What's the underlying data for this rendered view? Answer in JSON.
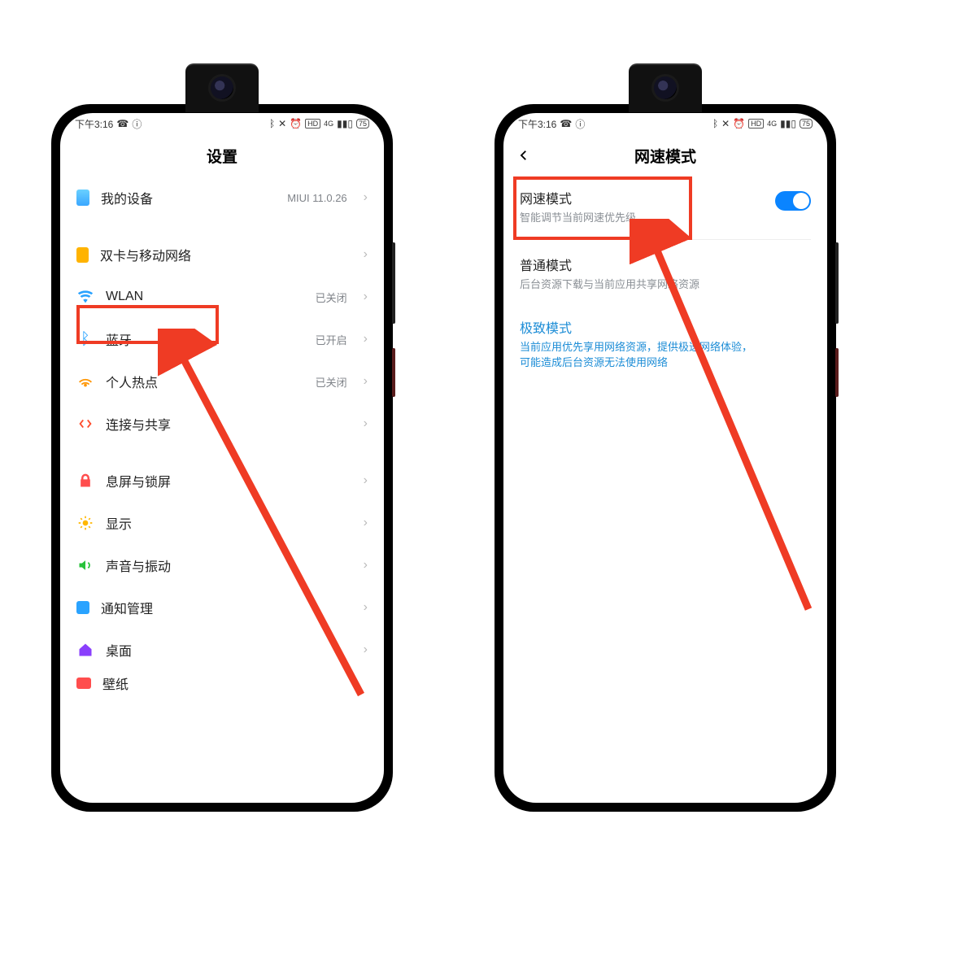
{
  "status": {
    "time": "下午3:16",
    "battery": "75"
  },
  "left": {
    "title": "设置",
    "device": {
      "label": "我的设备",
      "value": "MIUI 11.0.26"
    },
    "network": [
      {
        "name": "sim",
        "label": "双卡与移动网络"
      },
      {
        "name": "wlan",
        "label": "WLAN",
        "value": "已关闭"
      },
      {
        "name": "bt",
        "label": "蓝牙",
        "value": "已开启"
      },
      {
        "name": "hotspot",
        "label": "个人热点",
        "value": "已关闭"
      },
      {
        "name": "share",
        "label": "连接与共享"
      }
    ],
    "system": [
      {
        "name": "lock",
        "label": "息屏与锁屏"
      },
      {
        "name": "display",
        "label": "显示"
      },
      {
        "name": "sound",
        "label": "声音与振动"
      },
      {
        "name": "notif",
        "label": "通知管理"
      },
      {
        "name": "home",
        "label": "桌面"
      },
      {
        "name": "wall",
        "label": "壁纸"
      }
    ]
  },
  "right": {
    "title": "网速模式",
    "mode": {
      "title": "网速模式",
      "desc": "智能调节当前网速优先级"
    },
    "normal": {
      "title": "普通模式",
      "desc": "后台资源下载与当前应用共享网络资源"
    },
    "extreme": {
      "title": "极致模式",
      "desc": "当前应用优先享用网络资源，提供极速网络体验，可能造成后台资源无法使用网络"
    }
  }
}
